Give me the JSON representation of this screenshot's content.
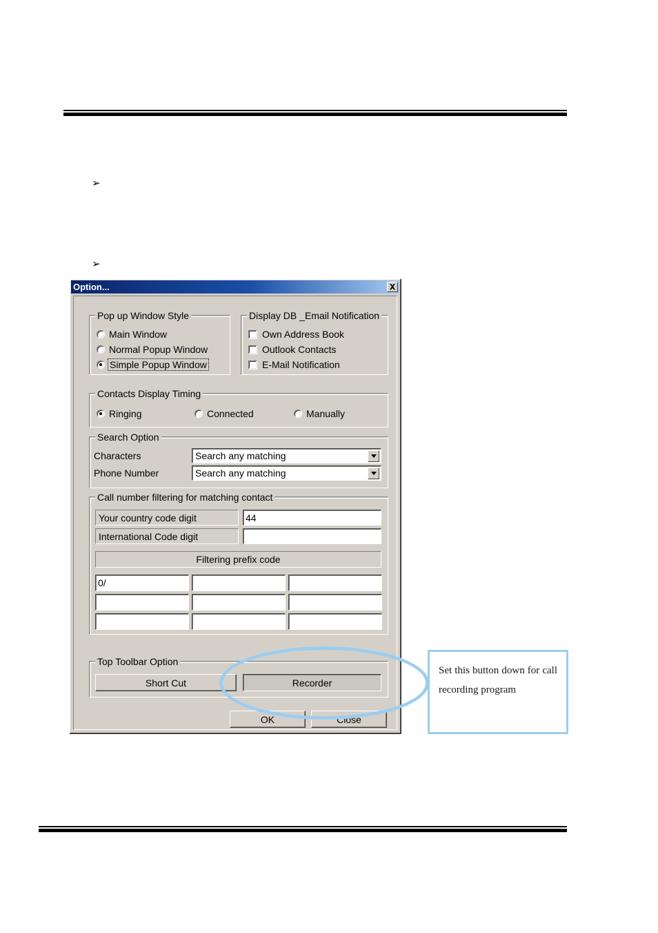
{
  "document": {
    "bullets": [
      "➢",
      "➢"
    ]
  },
  "dialog": {
    "title": "Option...",
    "close_icon": "close-icon",
    "popup_style": {
      "legend": "Pop up Window Style",
      "options": [
        {
          "label": "Main Window",
          "selected": false
        },
        {
          "label": "Normal Popup Window",
          "selected": false
        },
        {
          "label": "Simple Popup Window",
          "selected": true
        }
      ]
    },
    "display_db": {
      "legend": "Display DB _Email Notification",
      "options": [
        {
          "label": "Own Address Book",
          "checked": false
        },
        {
          "label": "Outlook Contacts",
          "checked": false
        },
        {
          "label": "E-Mail Notification",
          "checked": false
        }
      ]
    },
    "contacts_timing": {
      "legend": "Contacts Display Timing",
      "options": [
        {
          "label": "Ringing",
          "selected": true
        },
        {
          "label": "Connected",
          "selected": false
        },
        {
          "label": "Manually",
          "selected": false
        }
      ]
    },
    "search_option": {
      "legend": "Search Option",
      "rows": [
        {
          "label": "Characters",
          "value": "Search any matching"
        },
        {
          "label": "Phone Number",
          "value": "Search any matching"
        }
      ]
    },
    "call_filtering": {
      "legend": "Call number filtering for matching contact",
      "country_code_label": "Your country code digit",
      "country_code_value": "44",
      "international_code_label": "International Code digit",
      "international_code_value": "",
      "prefix_header": "Filtering prefix code",
      "prefix_cells": [
        "0/",
        "",
        "",
        "",
        "",
        "",
        "",
        "",
        ""
      ]
    },
    "top_toolbar": {
      "legend": "Top Toolbar Option",
      "shortcut_label": "Short Cut",
      "recorder_label": "Recorder",
      "recorder_pressed": true
    },
    "footer": {
      "ok_label": "OK",
      "close_label": "Close"
    }
  },
  "annotation": {
    "text": "Set this button down for call recording program",
    "color": "#9ccdf0"
  }
}
